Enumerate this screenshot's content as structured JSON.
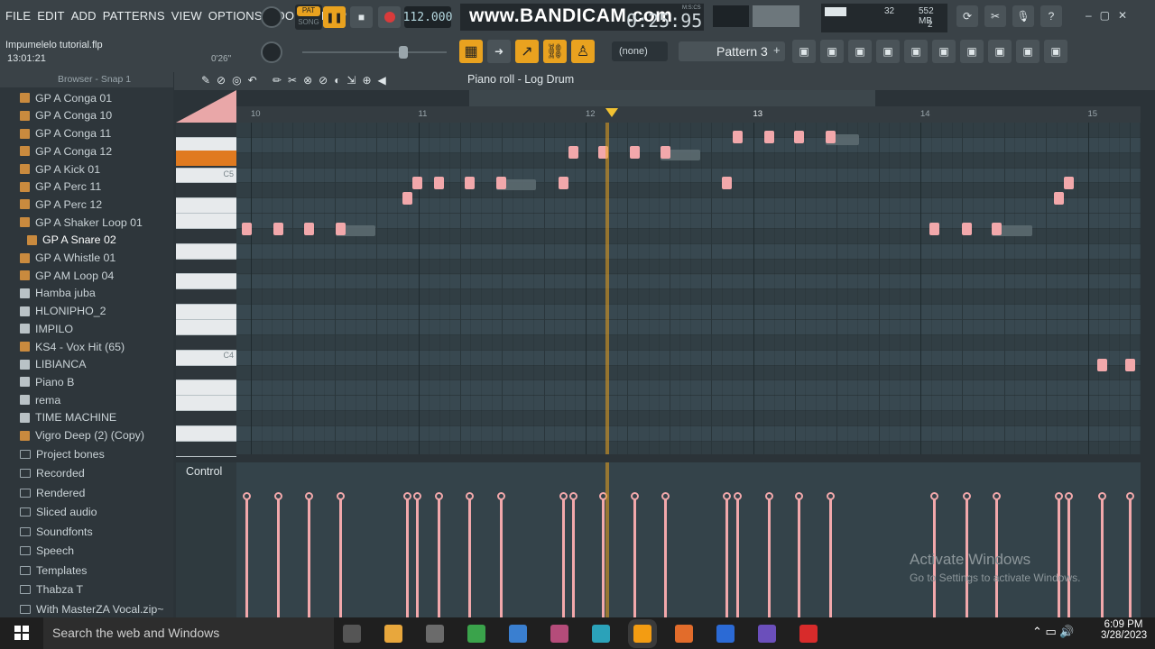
{
  "menu": [
    "FILE",
    "EDIT",
    "ADD",
    "PATTERNS",
    "VIEW",
    "OPTIONS",
    "TOOLS",
    "HELP"
  ],
  "transport": {
    "pat_label": "PAT",
    "song_label": "SONG",
    "tempo": "112.000",
    "time": "0:25:95",
    "time_units": "M:S:CS"
  },
  "watermark": "www.BANDICAM.com",
  "project": {
    "name": "Impumelelo tutorial.flp",
    "clock": "13:01:21",
    "hint_time": "0'26\""
  },
  "monitor": {
    "cpu": "32",
    "memory": "552 MB",
    "voices": "2"
  },
  "pattern": {
    "channel": "(none)",
    "name": "Pattern 3",
    "add": "+"
  },
  "browser": {
    "title": "Browser - Snap 1",
    "items": [
      {
        "label": "GP A Conga 01",
        "type": "audio"
      },
      {
        "label": "GP A Conga 10",
        "type": "audio"
      },
      {
        "label": "GP A Conga 11",
        "type": "audio"
      },
      {
        "label": "GP A Conga 12",
        "type": "audio"
      },
      {
        "label": "GP A Kick 01",
        "type": "audio"
      },
      {
        "label": "GP A Perc 11",
        "type": "audio"
      },
      {
        "label": "GP A Perc 12",
        "type": "audio"
      },
      {
        "label": "GP A Shaker Loop 01",
        "type": "audio"
      },
      {
        "label": "GP A Snare 02",
        "type": "audio",
        "selected": true
      },
      {
        "label": "GP A Whistle 01",
        "type": "audio"
      },
      {
        "label": "GP AM Loop 04",
        "type": "audio"
      },
      {
        "label": "Hamba juba",
        "type": "file"
      },
      {
        "label": "HLONIPHO_2",
        "type": "file"
      },
      {
        "label": "IMPILO",
        "type": "file"
      },
      {
        "label": "KS4 - Vox Hit (65)",
        "type": "audio"
      },
      {
        "label": "LIBIANCA",
        "type": "file"
      },
      {
        "label": "Piano B",
        "type": "file"
      },
      {
        "label": "rema",
        "type": "file"
      },
      {
        "label": "TIME MACHINE",
        "type": "file"
      },
      {
        "label": "Vigro Deep (2) (Copy)",
        "type": "audio"
      }
    ],
    "folders": [
      "Project bones",
      "Recorded",
      "Rendered",
      "Sliced audio",
      "Soundfonts",
      "Speech",
      "Templates",
      "Thabza T",
      "With MasterZA Vocal.zip~"
    ]
  },
  "piano_roll": {
    "title": "Piano roll - Log Drum",
    "bars": [
      "10",
      "11",
      "12",
      "13",
      "14",
      "15"
    ],
    "key_labels": [
      "C5",
      "C4"
    ],
    "control_label": "Control"
  },
  "notes": [
    {
      "bar": 10.0,
      "row": 7
    },
    {
      "bar": 10.19,
      "row": 7
    },
    {
      "bar": 10.37,
      "row": 7
    },
    {
      "bar": 10.56,
      "row": 7
    },
    {
      "bar": 10.96,
      "row": 5
    },
    {
      "bar": 11.02,
      "row": 4
    },
    {
      "bar": 11.15,
      "row": 4
    },
    {
      "bar": 11.33,
      "row": 4
    },
    {
      "bar": 11.52,
      "row": 4
    },
    {
      "bar": 11.89,
      "row": 4
    },
    {
      "bar": 11.95,
      "row": 2
    },
    {
      "bar": 12.13,
      "row": 2
    },
    {
      "bar": 12.32,
      "row": 2
    },
    {
      "bar": 12.5,
      "row": 2
    },
    {
      "bar": 12.87,
      "row": 4
    },
    {
      "bar": 12.93,
      "row": 1
    },
    {
      "bar": 13.12,
      "row": 1
    },
    {
      "bar": 13.3,
      "row": 1
    },
    {
      "bar": 13.49,
      "row": 1
    },
    {
      "bar": 14.11,
      "row": 7
    },
    {
      "bar": 14.3,
      "row": 7
    },
    {
      "bar": 14.48,
      "row": 7
    },
    {
      "bar": 14.85,
      "row": 5
    },
    {
      "bar": 14.91,
      "row": 4
    },
    {
      "bar": 15.11,
      "row": 16
    },
    {
      "bar": 15.28,
      "row": 16
    }
  ],
  "ghosts": [
    {
      "bar": 10.56,
      "row": 7,
      "len": 0.24
    },
    {
      "bar": 11.52,
      "row": 4,
      "len": 0.24
    },
    {
      "bar": 12.5,
      "row": 2,
      "len": 0.24
    },
    {
      "bar": 13.49,
      "row": 1,
      "len": 0.2
    },
    {
      "bar": 14.48,
      "row": 7,
      "len": 0.24
    }
  ],
  "playhead_bar": 12.15,
  "activate": {
    "line1": "Activate Windows",
    "line2": "Go to Settings to activate Windows."
  },
  "taskbar": {
    "search": "Search the web and Windows",
    "time": "6:09 PM",
    "date": "3/28/2023"
  },
  "colors": {
    "accent": "#e9a21f",
    "note": "#f2a8ab",
    "grid": "#36444a"
  }
}
